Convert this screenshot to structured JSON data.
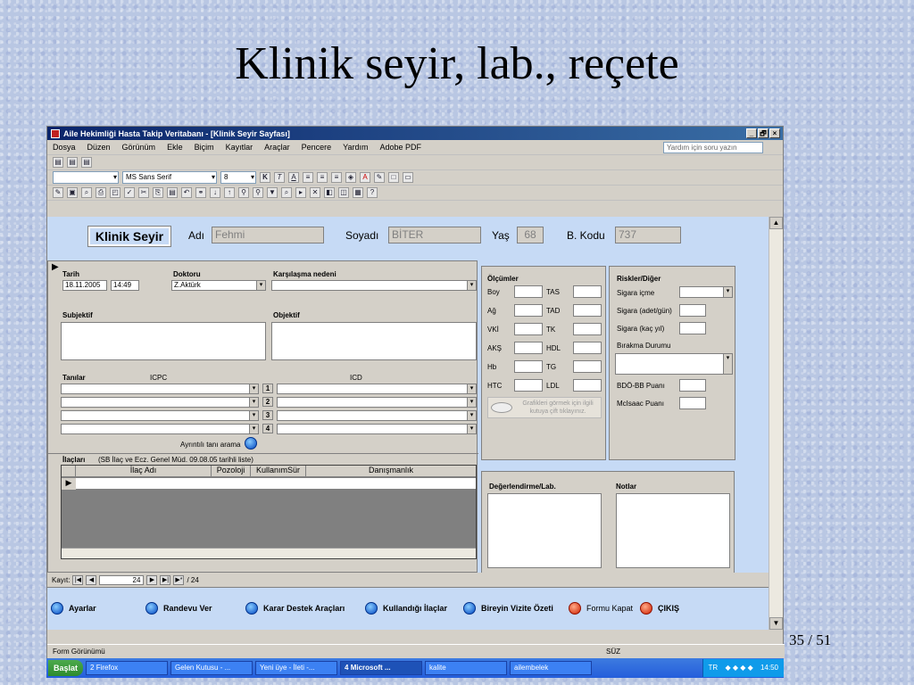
{
  "slide": {
    "title": "Klinik seyir, lab., reçete",
    "page": "35",
    "total": "/ 51"
  },
  "window": {
    "title": "Aile Hekimliği Hasta Takip Veritabanı - [Klinik Seyir Sayfası]",
    "min": "_",
    "max": "🗗",
    "close": "×"
  },
  "menu": {
    "items": [
      "Dosya",
      "Düzen",
      "Görünüm",
      "Ekle",
      "Biçim",
      "Kayıtlar",
      "Araçlar",
      "Pencere",
      "Yardım",
      "Adobe PDF"
    ],
    "help_placeholder": "Yardım için soru yazın"
  },
  "toolbar": {
    "font": "MS Sans Serif",
    "size": "8",
    "bold": "K",
    "italic": "T",
    "underline": "A"
  },
  "header": {
    "title": "Klinik Seyir",
    "adi_label": "Adı",
    "adi_value": "Fehmi",
    "soyadi_label": "Soyadı",
    "soyadi_value": "BİTER",
    "yas_label": "Yaş",
    "yas_value": "68",
    "bkodu_label": "B. Kodu",
    "bkodu_value": "737"
  },
  "left": {
    "tarih_label": "Tarih",
    "tarih_value": "18.11.2005",
    "saat_value": "14:49",
    "doktor_label": "Doktoru",
    "doktor_value": "Z.Aktürk",
    "karsilasma_label": "Karşılaşma nedeni",
    "subjektif_label": "Subjektif",
    "objektif_label": "Objektif",
    "tanilar_label": "Tanılar",
    "icpc_label": "ICPC",
    "icd_label": "ICD",
    "numbers": [
      "1",
      "2",
      "3",
      "4"
    ],
    "ayrintili_label": "Ayrıntılı tanı arama",
    "ilaclar_label": "İlaçları",
    "ilaclar_note": "(SB İlaç ve Ecz. Genel Müd. 09.08.05 tarihli liste)",
    "columns": [
      "İlaç Adı",
      "Pozoloji",
      "KullanımSür",
      "Danışmanlık"
    ]
  },
  "olcumler": {
    "title": "Ölçümler",
    "left_labels": [
      "Boy",
      "Ağ",
      "VKİ",
      "AKŞ",
      "Hb",
      "HTC"
    ],
    "right_labels": [
      "TAS",
      "TAD",
      "TK",
      "HDL",
      "TG",
      "LDL"
    ],
    "graph_note": "Grafikleri görmek için ilgili kutuya çift tıklayınız."
  },
  "riskler": {
    "title": "Riskler/Diğer",
    "sigara_icme": "Sigara içme",
    "sigara_adet": "Sigara (adet/gün)",
    "sigara_yil": "Sigara (kaç yıl)",
    "birakma": "Bırakma Durumu",
    "bdo": "BDÖ-BB Puanı",
    "mcisaac": "McIsaac Puanı"
  },
  "degerlendirme": {
    "title": "Değerlendirme/Lab.",
    "notlar": "Notlar"
  },
  "record": {
    "label": "Kayıt:",
    "current": "24",
    "total": "/ 24"
  },
  "buttons": [
    "Ayarlar",
    "Randevu Ver",
    "Karar Destek Araçları",
    "Kullandığı İlaçlar",
    "Bireyin Vizite Özeti",
    "Formu Kapat",
    "ÇIKIŞ"
  ],
  "status": {
    "left": "Form Görünümü",
    "right": "SÜZ"
  },
  "taskbar": {
    "start": "Başlat",
    "tasks": [
      "2 Firefox",
      "Gelen Kutusu - ...",
      "Yeni üye - İleti -...",
      "4 Microsoft ...",
      "kalite",
      "ailembelek"
    ],
    "tray_lang": "TR",
    "clock": "14:50"
  },
  "colors": {
    "form_bg": "#c6daf5",
    "title_bar": "#0a246a",
    "taskbar": "#245edb"
  }
}
